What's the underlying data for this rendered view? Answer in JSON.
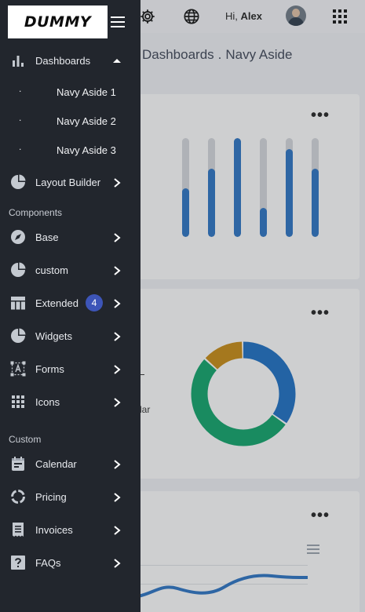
{
  "header": {
    "greeting_prefix": "Hi,",
    "user_name": "Alex",
    "icons": [
      "gear-icon",
      "globe-icon",
      "avatar",
      "apps-grid-icon"
    ]
  },
  "breadcrumb": {
    "items": [
      "Dashboards",
      "Navy Aside"
    ],
    "separator": "."
  },
  "cards": {
    "more_label": "•••",
    "bar_card": {
      "levels": [
        0.49,
        0.69,
        1.0,
        0.29,
        0.89,
        0.69
      ],
      "fill_color": "#2a73c5"
    },
    "donut_card": {
      "segments": [
        {
          "value": 35,
          "color": "#1b6fc4"
        },
        {
          "value": 52,
          "color": "#0ea56a"
        },
        {
          "value": 13,
          "color": "#c98b12"
        }
      ],
      "legend_fragment": "lar"
    },
    "line_card": {
      "line_color": "#2a73c5"
    }
  },
  "sidebar": {
    "brand": "DUMMY",
    "menu_icon": "hamburger-icon",
    "dashboards": {
      "label": "Dashboards",
      "icon": "bar-chart-icon",
      "sub_items": [
        {
          "bullet": ".",
          "label": "Navy Aside 1"
        },
        {
          "bullet": ".",
          "label": "Navy Aside 2"
        },
        {
          "bullet": ".",
          "label": "Navy Aside 3"
        }
      ]
    },
    "layout_builder": {
      "label": "Layout Builder",
      "icon": "pie-chart-icon"
    },
    "components_section": "Components",
    "components": [
      {
        "label": "Base",
        "icon": "compass-icon"
      },
      {
        "label": "custom",
        "icon": "pie-chart-icon"
      },
      {
        "label": "Extended",
        "icon": "table-icon",
        "badge": "4"
      },
      {
        "label": "Widgets",
        "icon": "pie-chart-icon"
      },
      {
        "label": "Forms",
        "icon": "text-field-icon"
      },
      {
        "label": "Icons",
        "icon": "grid-icon"
      }
    ],
    "custom_section": "Custom",
    "custom": [
      {
        "label": "Calendar",
        "icon": "calendar-icon"
      },
      {
        "label": "Pricing",
        "icon": "circle-notch-icon"
      },
      {
        "label": "Invoices",
        "icon": "receipt-icon"
      },
      {
        "label": "FAQs",
        "icon": "question-icon"
      }
    ],
    "colors": {
      "background": "#22262d",
      "badge": "#3d55b8"
    }
  }
}
